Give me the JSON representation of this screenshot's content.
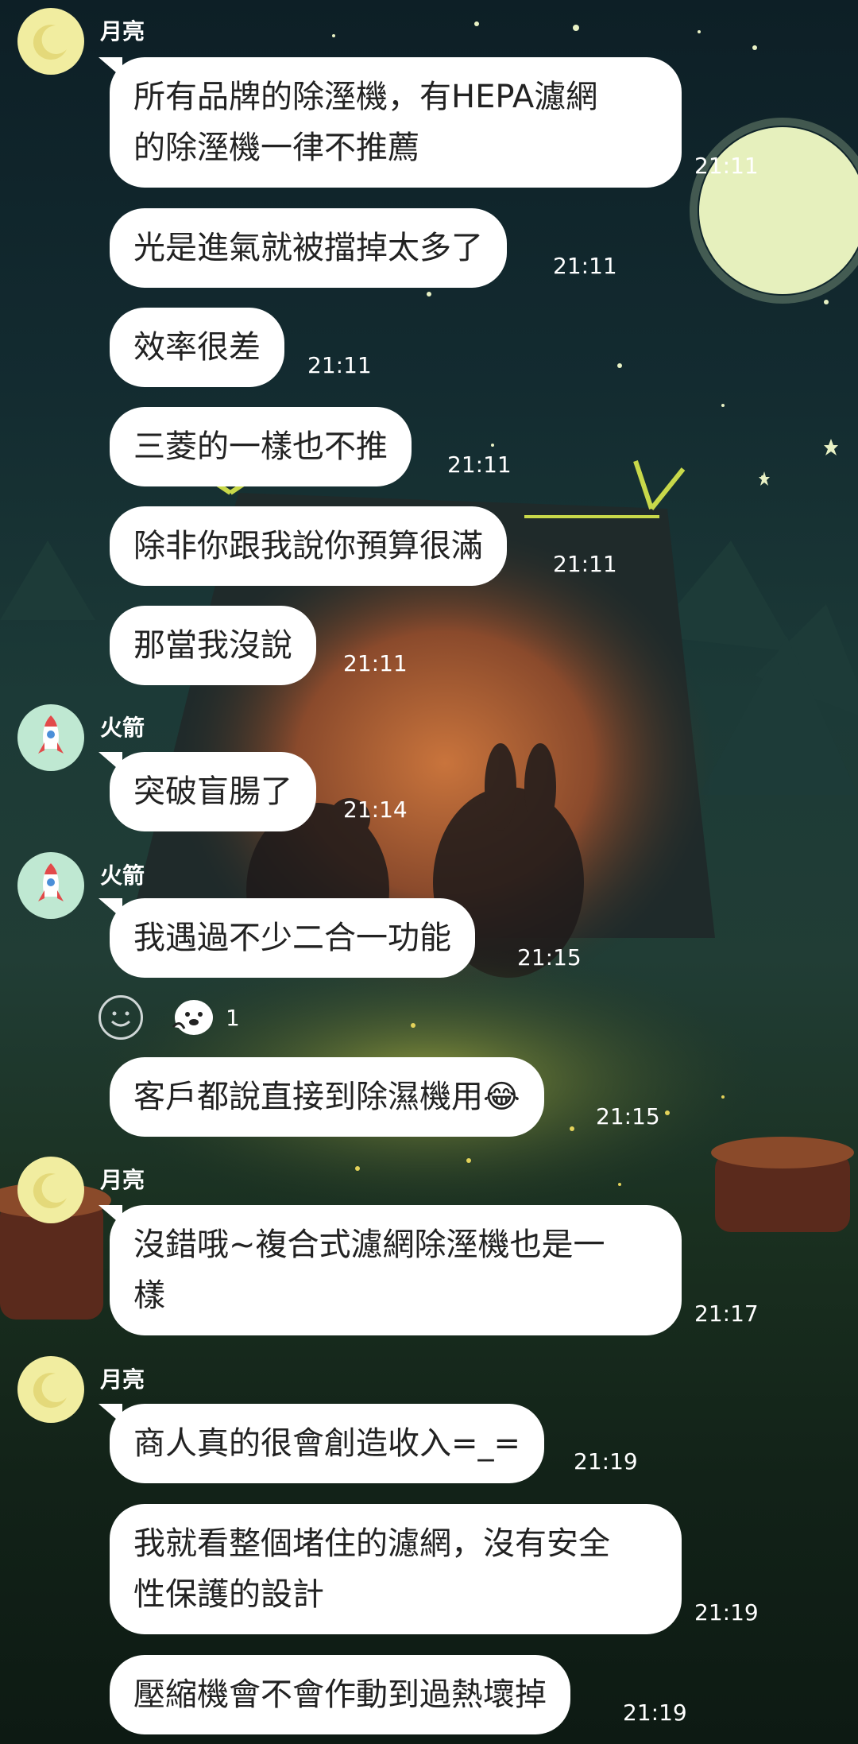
{
  "senders": {
    "moon": "月亮",
    "rocket": "火箭"
  },
  "messages": [
    {
      "text": "所有品牌的除溼機，有HEPA濾網\n的除溼機一律不推薦",
      "time": "21:11"
    },
    {
      "text": "光是進氣就被擋掉太多了",
      "time": "21:11"
    },
    {
      "text": "效率很差",
      "time": "21:11"
    },
    {
      "text": "三菱的一樣也不推",
      "time": "21:11"
    },
    {
      "text": "除非你跟我說你預算很滿",
      "time": "21:11"
    },
    {
      "text": "那當我沒說",
      "time": "21:11"
    },
    {
      "text": "突破盲腸了",
      "time": "21:14"
    },
    {
      "text": "我遇過不少二合一功能",
      "time": "21:15"
    },
    {
      "text": "客戶都說直接到除濕機用😂",
      "time": "21:15"
    },
    {
      "text": "沒錯哦~複合式濾網除溼機也是一\n樣",
      "time": "21:17"
    },
    {
      "text": "商人真的很會創造收入=_=",
      "time": "21:19"
    },
    {
      "text": "我就看整個堵住的濾網，沒有安全\n性保護的設計",
      "time": "21:19"
    },
    {
      "text": "壓縮機會不會作動到過熱壞掉",
      "time": "21:19"
    }
  ],
  "reaction": {
    "count": "1"
  },
  "colors": {
    "bubble": "#ffffff",
    "moon_avatar": "#f1eda0",
    "rocket_avatar": "#bfe8d2"
  }
}
